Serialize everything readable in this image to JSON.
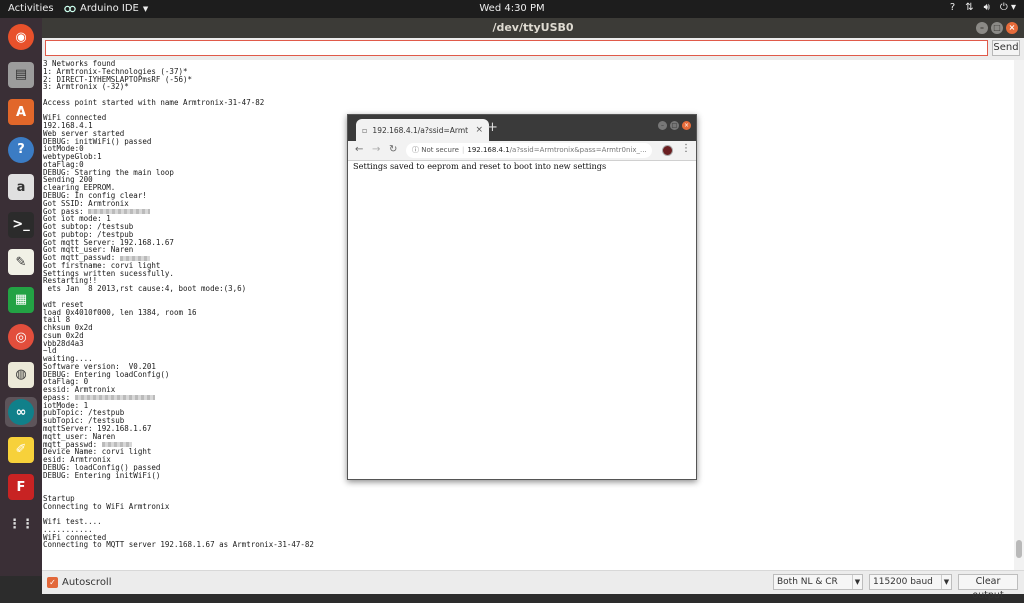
{
  "topbar": {
    "activities": "Activities",
    "app_menu": "Arduino IDE",
    "clock": "Wed  4:30 PM",
    "tray_help": "?",
    "tray_icons": [
      "network-icon",
      "volume-icon",
      "power-icon"
    ]
  },
  "dock": {
    "items": [
      {
        "name": "firefox-icon",
        "color": "#e8512b"
      },
      {
        "name": "files-icon",
        "color": "#9c9c9c"
      },
      {
        "name": "software-center-icon",
        "color": "#e1672a"
      },
      {
        "name": "help-icon",
        "color": "#3b7cc4"
      },
      {
        "name": "amazon-icon",
        "color": "#e0e0e0"
      },
      {
        "name": "terminal-icon",
        "color": "#2b2b2b"
      },
      {
        "name": "text-editor-icon",
        "color": "#f1f1e6"
      },
      {
        "name": "spreadsheet-icon",
        "color": "#23a244"
      },
      {
        "name": "chrome-icon",
        "color": "#e24e3c"
      },
      {
        "name": "speaker-icon",
        "color": "#ece9d8"
      },
      {
        "name": "arduino-icon",
        "color": "#10808a"
      },
      {
        "name": "notes-icon",
        "color": "#f7d13a"
      },
      {
        "name": "filezilla-icon",
        "color": "#c82323"
      },
      {
        "name": "app-grid-icon",
        "color": "#dddddd"
      }
    ]
  },
  "window": {
    "title": "/dev/ttyUSB0",
    "send_value": "",
    "send_label": "Send",
    "serial_lines": [
      "3 Networks found",
      "1: Armtronix-Technologies (-37)*",
      "2: DIRECT-IYHEMSLAPTOPmsRF (-56)*",
      "3: Armtronix (-32)*",
      "",
      "Access point started with name Armtronix-31-47-82",
      "",
      "WiFi connected",
      "192.168.4.1",
      "Web server started",
      "DEBUG: initWiFi() passed",
      "iotMode:0",
      "webtypeGlob:1",
      "otaFlag:0",
      "DEBUG: Starting the main loop",
      "Sending 200",
      "clearing EEPROM.",
      "DEBUG: In config clear!",
      "Got SSID: Armtronix",
      "Got pass: ",
      "Got iot mode: 1",
      "Got subtop: /testsub",
      "Got pubtop: /testpub",
      "Got mqtt Server: 192.168.1.67",
      "Got mqtt_user: Naren",
      "Got mqtt_passwd: ",
      "Got firstname: corvi light",
      "Settings written sucessfully.",
      "Restarting!!",
      " ets Jan  8 2013,rst cause:4, boot mode:(3,6)",
      "",
      "wdt reset",
      "load 0x4010f000, len 1384, room 16",
      "tail 8",
      "chksum 0x2d",
      "csum 0x2d",
      "vbb28d4a3",
      "~ld",
      "waiting....",
      "Software version:  V0.201",
      "DEBUG: Entering loadConfig()",
      "otaFlag: 0",
      "essid: Armtronix",
      "epass: ",
      "iotMode: 1",
      "pubTopic: /testpub",
      "subTopic: /testsub",
      "mqttServer: 192.168.1.67",
      "mqtt_user: Naren",
      "mqtt_passwd: ",
      "Device Name: corvi light",
      "esid: Armtronix",
      "DEBUG: loadConfig() passed",
      "DEBUG: Entering initWiFi()",
      "",
      "",
      "Startup",
      "Connecting to WiFi Armtronix",
      "",
      "Wifi test....",
      "...........",
      "WiFi connected",
      "Connecting to MQTT server 192.168.1.67 as Armtronix-31-47-82"
    ],
    "autoscroll_label": "Autoscroll",
    "autoscroll_checked": true,
    "line_ending": "Both NL & CR",
    "baud": "115200 baud",
    "clear_label": "Clear output"
  },
  "browser": {
    "tab_title": "192.168.4.1/a?ssid=Armt",
    "secure_label": "Not secure",
    "url_host": "192.168.4.1",
    "url_rest": "/a?ssid=Armtronix&pass=Armtr0nix_...",
    "page_message": "Settings saved to eeprom and reset to boot into new settings"
  }
}
